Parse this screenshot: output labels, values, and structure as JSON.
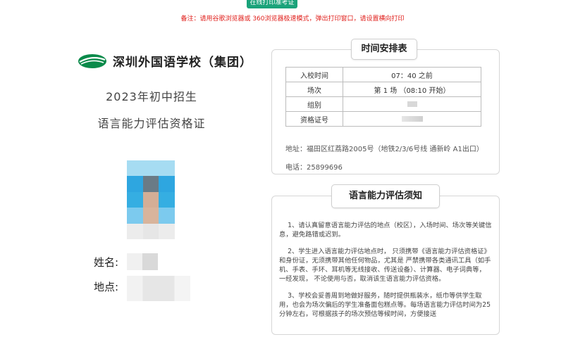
{
  "toolbar": {
    "print_label": "在线打印准考证"
  },
  "notice": "备注：请用谷歌浏览器或 360浏览器极速模式，弹出打印窗口，请设置横向打印",
  "school": {
    "name": "深圳外国语学校（集团）"
  },
  "exam_title": "2023年初中招生",
  "cert_title": "语言能力评估资格证",
  "labels": {
    "name": "姓名:",
    "site": "地点:"
  },
  "schedule": {
    "title": "时间安排表",
    "rows": [
      {
        "key": "入校时间",
        "value": "07：40 之前"
      },
      {
        "key": "场次",
        "value": "第 1 场 （08:10 开始）"
      },
      {
        "key": "组别",
        "value": ""
      },
      {
        "key": "资格证号",
        "value": ""
      }
    ],
    "address": "地址：福田区红荔路2005号（地铁2/3/6号线 通新岭 A1出口）",
    "phone": "电话：25899696"
  },
  "rules": {
    "title": "语言能力评估须知",
    "items": [
      "1、请认真留意语言能力评估的地点（校区），入场时间、场次等关键信息，避免路错或迟到。",
      "2、学生进入语言能力评估地点时， 只须携带《语言能力评估资格证》和身份证，无须携带其他任何物品，尤其是 严禁携带各类通讯工具（如手机、手表、手环、耳机等无线接收、传送设备）、计算器、电子词典等， 一经发现， 不论使用与否，取消该生语言能力评估资格。",
      "3、学校会妥善周到地做好服务，随时提供瓶装水，纸巾等供学生取用，也会为场次偏后的学生准备面包糕点等。每场语言能力评估时间为25分钟左右，可根据孩子的场次预估等候时间，方便接送"
    ]
  },
  "colors": {
    "accent": "#1aa37a",
    "notice": "#e0201c",
    "logo": "#0a8a4a"
  }
}
